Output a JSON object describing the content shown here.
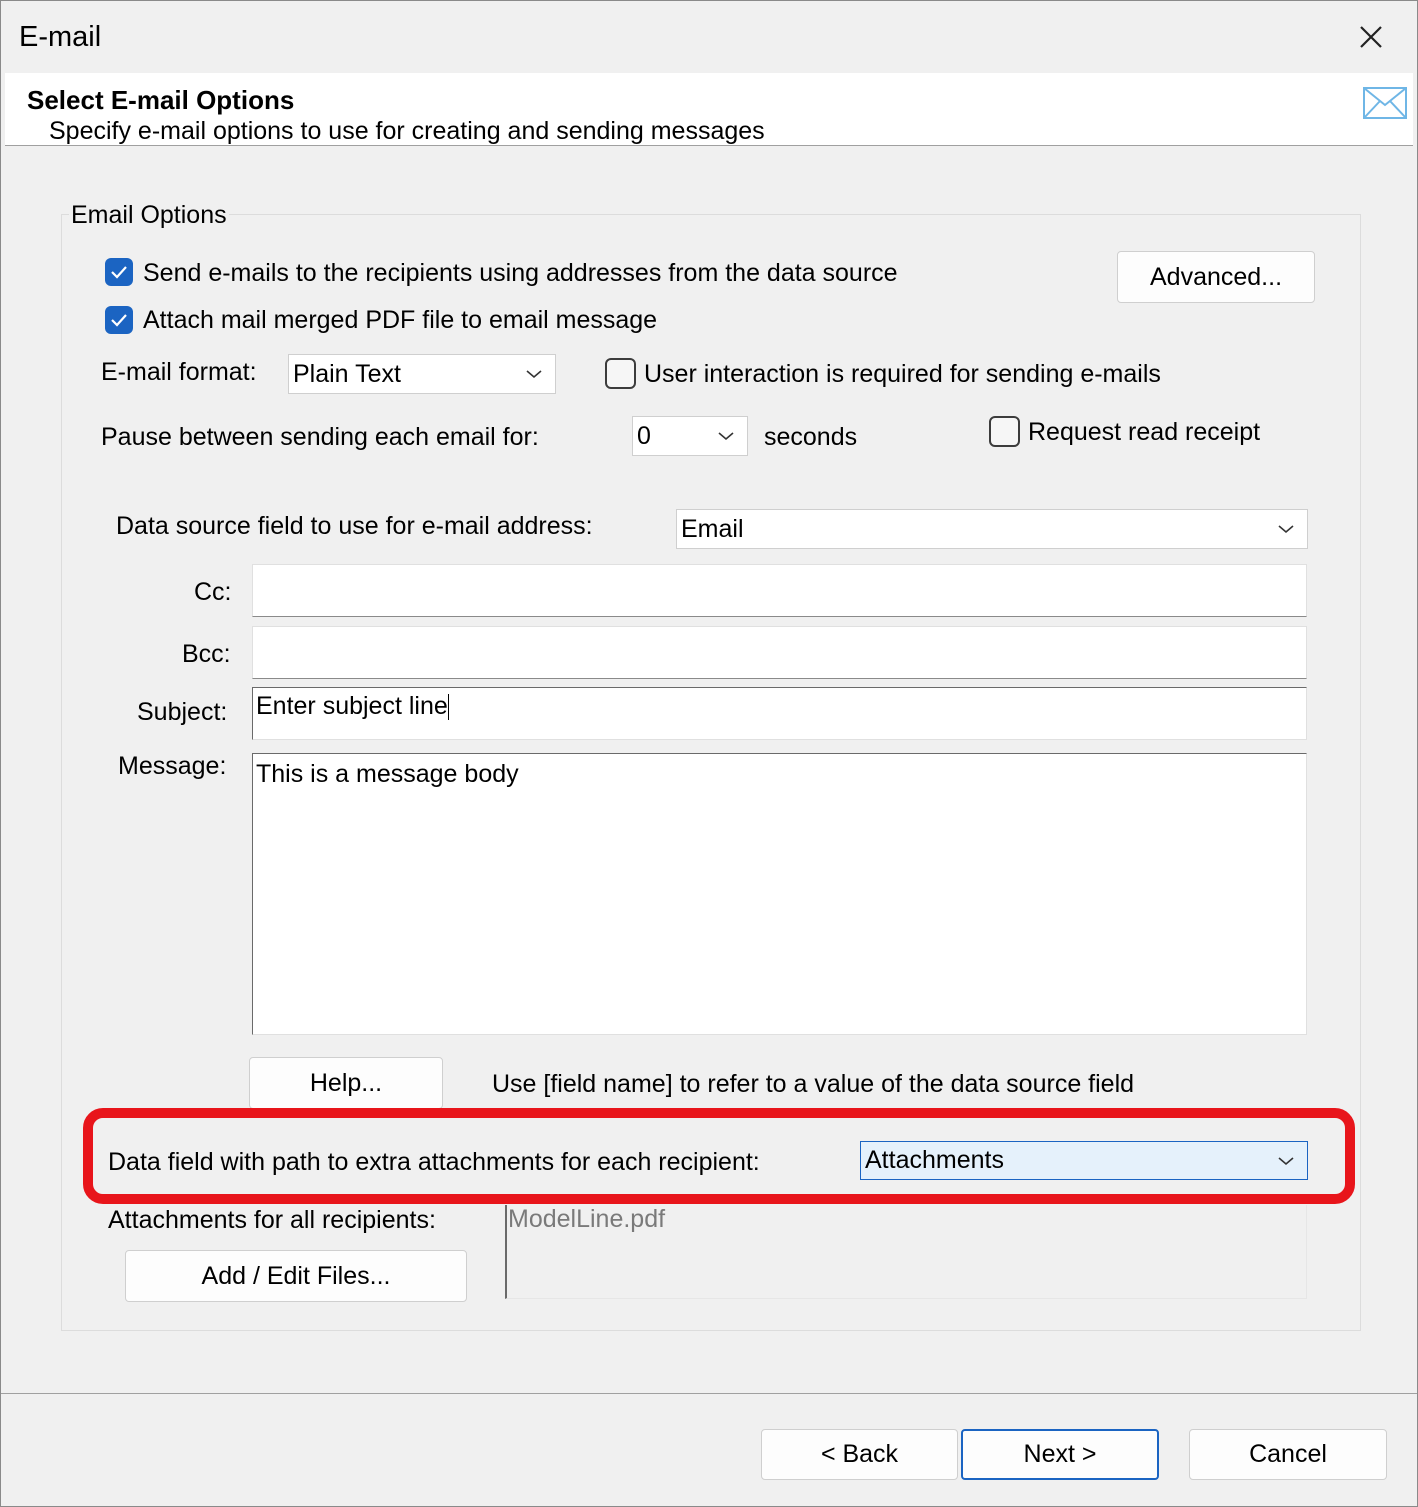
{
  "window": {
    "title": "E-mail"
  },
  "header": {
    "title": "Select E-mail Options",
    "subtitle": "Specify e-mail options to use for creating and sending messages"
  },
  "group": {
    "label": "Email Options"
  },
  "options": {
    "send_emails": {
      "label": "Send e-mails to the recipients using addresses from the data source",
      "checked": true
    },
    "attach_pdf": {
      "label": "Attach mail merged PDF file to email message",
      "checked": true
    },
    "advanced_label": "Advanced...",
    "format_label": "E-mail format:",
    "format_value": "Plain Text",
    "user_interaction": {
      "label": "User interaction is required for sending e-mails",
      "checked": false
    },
    "pause_label": "Pause between sending each email for:",
    "pause_value": "0",
    "pause_unit": "seconds",
    "read_receipt": {
      "label": "Request read receipt",
      "checked": false
    }
  },
  "fields": {
    "email_field_label": "Data source field to use for e-mail address:",
    "email_field_value": "Email",
    "cc_label": "Cc:",
    "cc_value": "",
    "bcc_label": "Bcc:",
    "bcc_value": "",
    "subject_label": "Subject:",
    "subject_value": "Enter subject line",
    "message_label": "Message:",
    "message_value": "This is a message body",
    "help_label": "Help...",
    "help_hint": "Use [field name] to refer to a value of the data source field"
  },
  "attachments": {
    "extra_label": "Data field with path to extra attachments for each recipient:",
    "extra_value": "Attachments",
    "all_label": "Attachments for all recipients:",
    "add_edit_label": "Add / Edit Files...",
    "files": [
      "ModelLine.pdf"
    ]
  },
  "footer": {
    "back_label": "< Back",
    "next_label": "Next >",
    "cancel_label": "Cancel"
  },
  "colors": {
    "accent": "#1b64c2",
    "highlight": "#e8151b"
  }
}
